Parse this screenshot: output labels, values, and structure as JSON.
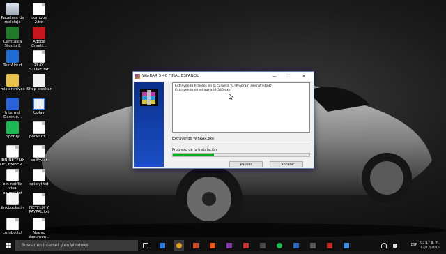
{
  "desktop": {
    "icons": [
      {
        "label": "Papelera de reciclaje"
      },
      {
        "label": "combos 2.txt"
      },
      {
        "label": "Camtasia Studio 8"
      },
      {
        "label": "Adobe Creati..."
      },
      {
        "label": "TextAloud"
      },
      {
        "label": "PLAY STORE.txt"
      },
      {
        "label": "mis archivos"
      },
      {
        "label": "Shop tracker"
      },
      {
        "label": "Internet Downlo..."
      },
      {
        "label": "Uplay"
      },
      {
        "label": "Spotify"
      },
      {
        "label": "pockiutt..."
      },
      {
        "label": "BIN NETFLIX DECEMBER..."
      },
      {
        "label": "spiffy.txt"
      },
      {
        "label": "bin netflix visa paypal.txt"
      },
      {
        "label": "spiloyl.txt"
      },
      {
        "label": "linkbucks.in"
      },
      {
        "label": "NETFLIX Y PAYPAL.txt"
      },
      {
        "label": "combo.txt"
      },
      {
        "label": "Nuevo documen..."
      }
    ]
  },
  "window": {
    "title": "WinRAR 5.40 FINAL ESPAÑOL",
    "minimize": "—",
    "maximize": "☐",
    "close": "✕",
    "log_lines": [
      "Extrayendo ficheros en la carpeta \"C:\\Program Files\\WinRAR\"",
      "Extrayendo de winrar-x64-540.exe"
    ],
    "current_file": "Extrayendo WinRAR.exe",
    "progress_label": "Progreso de la instalación",
    "progress": 0.3,
    "pause_button": "Pausar",
    "cancel_button": "Cancelar"
  },
  "taskbar": {
    "search_placeholder": "Buscar en Internet y en Windows",
    "language": "ESP",
    "time": "03:17 a. m.",
    "date": "12/12/2016"
  },
  "colors": {
    "progress_fill": "#06b025",
    "installer_panel": "#1b4fc6",
    "taskbar": "#101010"
  }
}
